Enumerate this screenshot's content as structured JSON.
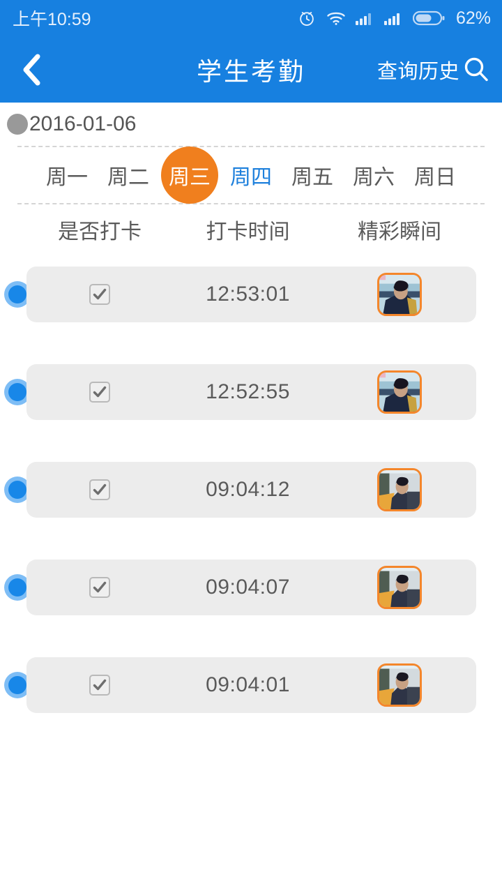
{
  "status_bar": {
    "time": "上午10:59",
    "battery_percent": "62%",
    "icons": [
      "alarm-clock-icon",
      "wifi-icon",
      "signal-bars-icon-1",
      "signal-bars-icon-2",
      "battery-icon"
    ]
  },
  "app_bar": {
    "back_icon": "chevron-left-icon",
    "title": "学生考勤",
    "history_label": "查询历史",
    "search_icon": "search-icon"
  },
  "date_bar": {
    "indicator_icon": "circle-dot-icon",
    "date": "2016-01-06"
  },
  "week_tabs": {
    "items": [
      {
        "label": "周一",
        "state": "normal"
      },
      {
        "label": "周二",
        "state": "normal"
      },
      {
        "label": "周三",
        "state": "selected"
      },
      {
        "label": "周四",
        "state": "today"
      },
      {
        "label": "周五",
        "state": "normal"
      },
      {
        "label": "周六",
        "state": "normal"
      },
      {
        "label": "周日",
        "state": "normal"
      }
    ]
  },
  "table": {
    "headers": [
      "是否打卡",
      "打卡时间",
      "精彩瞬间"
    ],
    "rows": [
      {
        "checked": true,
        "time": "12:53:01",
        "thumbnail": "student-photo-blue-jacket"
      },
      {
        "checked": true,
        "time": "12:52:55",
        "thumbnail": "student-photo-blue-jacket"
      },
      {
        "checked": true,
        "time": "09:04:12",
        "thumbnail": "student-photo-yellow-jacket"
      },
      {
        "checked": true,
        "time": "09:04:07",
        "thumbnail": "student-photo-yellow-jacket"
      },
      {
        "checked": true,
        "time": "09:04:01",
        "thumbnail": "student-photo-yellow-jacket"
      }
    ]
  },
  "colors": {
    "header_blue": "#1780E0",
    "accent_orange": "#F07F1E",
    "today_blue": "#1E80DC",
    "card_gray": "#ECECEC",
    "marker_blue": "#1887E8",
    "thumb_border": "#F4862B"
  }
}
